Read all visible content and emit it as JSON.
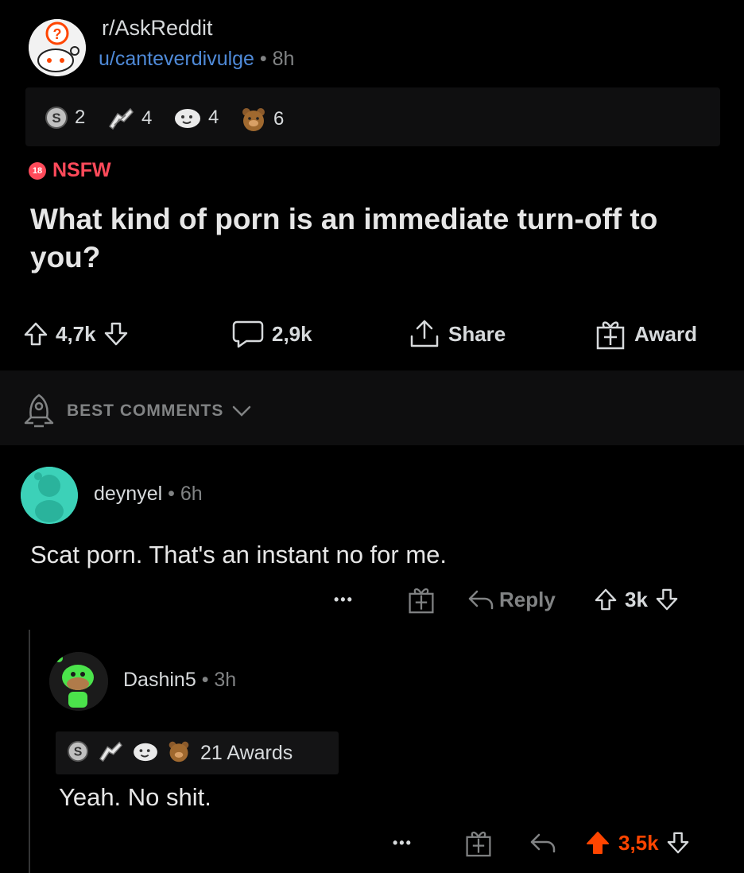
{
  "post": {
    "subreddit": "r/AskReddit",
    "author": "u/canteverdivulge",
    "separator": "•",
    "age": "8h",
    "awards": [
      {
        "icon": "silver-award-icon",
        "count": "2"
      },
      {
        "icon": "helpful-award-icon",
        "count": "4"
      },
      {
        "icon": "wholesome-award-icon",
        "count": "4"
      },
      {
        "icon": "bear-award-icon",
        "count": "6"
      }
    ],
    "nsfw_badge": "18",
    "nsfw_label": "NSFW",
    "title": "What kind of porn is an immediate turn-off to you?",
    "upvotes": "4,7k",
    "comments": "2,9k",
    "share_label": "Share",
    "award_label": "Award"
  },
  "sort": {
    "label": "BEST COMMENTS"
  },
  "comments": [
    {
      "author": "deynyel",
      "age": "6h",
      "body": "Scat porn. That's an instant no for me.",
      "more": "•••",
      "reply_label": "Reply",
      "score": "3k"
    },
    {
      "author": "Dashin5",
      "age": "3h",
      "awards_label": "21 Awards",
      "body": "Yeah. No shit.",
      "more": "•••",
      "score": "3,5k"
    }
  ],
  "colors": {
    "background": "#000000",
    "link_blue": "#4f8ad8",
    "nsfw_red": "#ff4a5a",
    "upvote_orange": "#ff4500",
    "muted": "#818384"
  }
}
